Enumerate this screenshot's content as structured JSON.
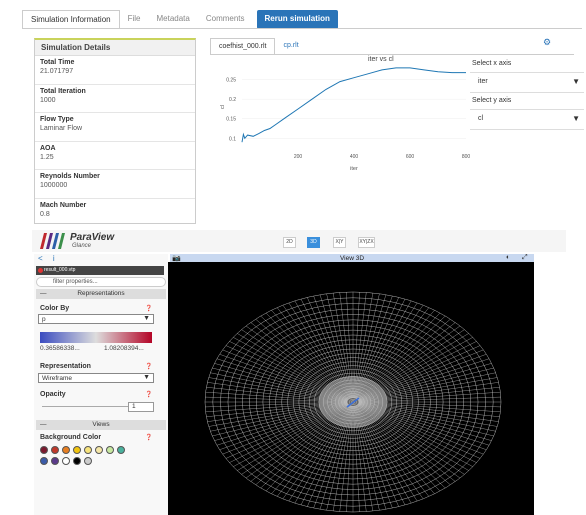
{
  "tabs": [
    {
      "label": "Simulation Information",
      "active": true
    },
    {
      "label": "File",
      "active": false
    },
    {
      "label": "Metadata",
      "active": false
    },
    {
      "label": "Comments",
      "active": false
    },
    {
      "label": "Rerun simulation",
      "primary": true
    }
  ],
  "details": {
    "title": "Simulation Details",
    "rows": [
      {
        "label": "Total Time",
        "value": "21.071797"
      },
      {
        "label": "Total Iteration",
        "value": "1000"
      },
      {
        "label": "Flow Type",
        "value": "Laminar Flow"
      },
      {
        "label": "AOA",
        "value": "1.25"
      },
      {
        "label": "Reynolds Number",
        "value": "1000000"
      },
      {
        "label": "Mach Number",
        "value": "0.8"
      }
    ]
  },
  "plot_tabs": [
    {
      "label": "coefhist_000.rlt",
      "active": true
    },
    {
      "label": "cp.rlt",
      "active": false
    }
  ],
  "axis_select": {
    "x_label": "Select x axis",
    "x_value": "iter",
    "y_label": "Select y axis",
    "y_value": "cl"
  },
  "chart_data": {
    "type": "line",
    "title": "iter vs cl",
    "xlabel": "iter",
    "ylabel": "cl",
    "x_ticks": [
      "200",
      "400",
      "600",
      "800"
    ],
    "y_ticks": [
      "0.1",
      "0.15",
      "0.2",
      "0.25"
    ],
    "xlim": [
      0,
      800
    ],
    "ylim": [
      0.07,
      0.29
    ],
    "series": [
      {
        "x": [
          0,
          5,
          10,
          20,
          40,
          60,
          80,
          100,
          120,
          150,
          200,
          250,
          300,
          350,
          400,
          450,
          500,
          550,
          600,
          650,
          700,
          750,
          800
        ],
        "y": [
          0.09,
          0.11,
          0.1,
          0.108,
          0.105,
          0.112,
          0.12,
          0.125,
          0.135,
          0.15,
          0.175,
          0.2,
          0.225,
          0.245,
          0.255,
          0.265,
          0.275,
          0.28,
          0.28,
          0.275,
          0.27,
          0.268,
          0.268
        ]
      }
    ]
  },
  "paraview": {
    "name": "ParaView",
    "sub": "Glance",
    "view_buttons": [
      "2D",
      "3D",
      "X|Y",
      "XY|ZX"
    ],
    "file": "result_000.vtp",
    "filter_placeholder": "filter properties...",
    "representations_header": "Representations",
    "color_by_label": "Color By",
    "color_by_value": "p",
    "range_min": "0.36586338...",
    "range_max": "1.08208394...",
    "representation_label": "Representation",
    "representation_value": "Wireframe",
    "opacity_label": "Opacity",
    "opacity_value": "1",
    "views_header": "Views",
    "bg_label": "Background Color",
    "view_title": "View 3D",
    "bg_colors": [
      "#7a1a2e",
      "#c0392b",
      "#e67e22",
      "#f1c40f",
      "#f7e37c",
      "#f5e7a8",
      "#c7e8a0",
      "#4ab19d",
      "#3b5ba8",
      "#5b3a8a",
      "#ffffff",
      "#000000",
      "#cccccc"
    ]
  }
}
